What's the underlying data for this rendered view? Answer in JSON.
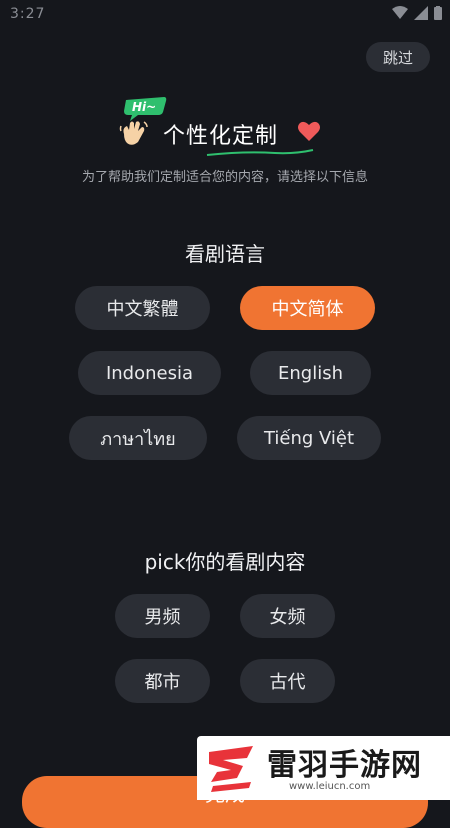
{
  "status_bar": {
    "time": "3:27"
  },
  "header": {
    "skip_label": "跳过"
  },
  "hero": {
    "badge_text": "Hi~",
    "title": "个性化定制",
    "subtitle": "为了帮助我们定制适合您的内容，请选择以下信息"
  },
  "language_section": {
    "title": "看剧语言",
    "options": [
      {
        "label": "中文繁體",
        "selected": false
      },
      {
        "label": "中文简体",
        "selected": true
      },
      {
        "label": "Indonesia",
        "selected": false
      },
      {
        "label": "English",
        "selected": false
      },
      {
        "label": "ภาษาไทย",
        "selected": false
      },
      {
        "label": "Tiếng Việt",
        "selected": false
      }
    ]
  },
  "content_section": {
    "title": "pick你的看剧内容",
    "options": [
      {
        "label": "男频"
      },
      {
        "label": "女频"
      },
      {
        "label": "都市"
      },
      {
        "label": "古代"
      }
    ]
  },
  "footer": {
    "button_label": "完成"
  },
  "watermark": {
    "title": "雷羽手游网",
    "url": "www.leiucn.com"
  },
  "colors": {
    "accent": "#f07432",
    "background": "#15171c",
    "chip": "#2b2e35"
  }
}
